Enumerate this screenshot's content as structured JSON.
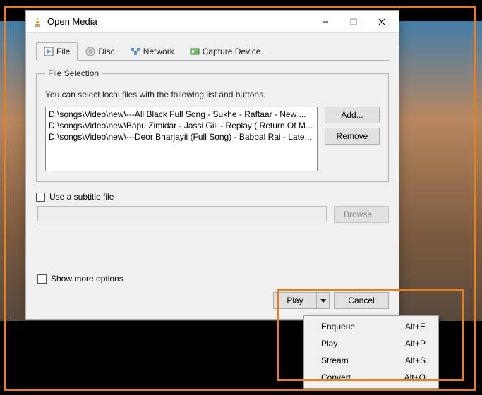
{
  "titlebar": {
    "title": "Open Media"
  },
  "tabs": {
    "file": "File",
    "disc": "Disc",
    "network": "Network",
    "capture": "Capture Device"
  },
  "fileSection": {
    "legend": "File Selection",
    "help": "You can select local files with the following list and buttons.",
    "files": [
      "D:\\songs\\Video\\new\\---All Black Full Song - Sukhe - Raftaar -  New ...",
      "D:\\songs\\Video\\new\\Bapu Zimidar - Jassi Gill - Replay ( Return Of M...",
      "D:\\songs\\Video\\new\\---Deor Bharjayii (Full Song) - Babbal Rai - Late..."
    ],
    "add": "Add...",
    "remove": "Remove"
  },
  "subtitle": {
    "label": "Use a subtitle file",
    "browse": "Browse..."
  },
  "options": {
    "showMore": "Show more options"
  },
  "bottom": {
    "play": "Play",
    "cancel": "Cancel"
  },
  "menu": {
    "enqueue": {
      "label": "Enqueue",
      "shortcut": "Alt+E"
    },
    "play": {
      "label": "Play",
      "shortcut": "Alt+P"
    },
    "stream": {
      "label": "Stream",
      "shortcut": "Alt+S"
    },
    "convert": {
      "label": "Convert",
      "shortcut": "Alt+O"
    }
  }
}
